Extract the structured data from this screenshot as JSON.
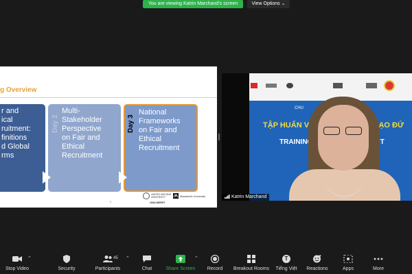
{
  "banner": {
    "viewing_text": "You are viewing Katrin Marchand's screen",
    "view_options_label": "View Options ⌄"
  },
  "slide": {
    "title": "g Overview",
    "cards": [
      {
        "text": "r and\nical\nruitment:\nfinitions\nd Global\nrms"
      },
      {
        "text": "Multi-\nStakeholder\nPerspective\non Fair and\nEthical\nRecruitment",
        "day_ghost": "Day 2"
      },
      {
        "text": "National\nFrameworks\non Fair and\nEthical\nRecruitment",
        "day_label": "Day 3"
      }
    ],
    "page_number": "3",
    "logos": {
      "un_text": "UNITED NATIONS\nUNIVERSITY",
      "maastricht_text": "Maastricht University",
      "unu_merit": "UNU-MERIT"
    }
  },
  "video": {
    "participant_name": "Katrin Marchand",
    "banner_line_chu": "CHU",
    "banner_line1": "TẬP HUẤN VỀ TUYỂN ... À CÓ ĐẠO ĐỨ",
    "banner_line2": "TRAINING ON ... RECRUITMENT"
  },
  "toolbar": {
    "stop_video": "Stop Video",
    "security": "Security",
    "participants": "Participants",
    "participants_count": "45",
    "chat": "Chat",
    "share_screen": "Share Screen",
    "record": "Record",
    "breakout_rooms": "Breakout Rooms",
    "language": "Tiếng Việt",
    "language_icon_letter": "T",
    "reactions": "Reactions",
    "apps": "Apps",
    "more": "More"
  },
  "colors": {
    "banner_green": "#2db34a",
    "card_dark_blue": "#3c5e94",
    "card_light_blue": "#90a6cd",
    "card_highlight_border": "#e8982e",
    "title_orange": "#e8a13a"
  }
}
